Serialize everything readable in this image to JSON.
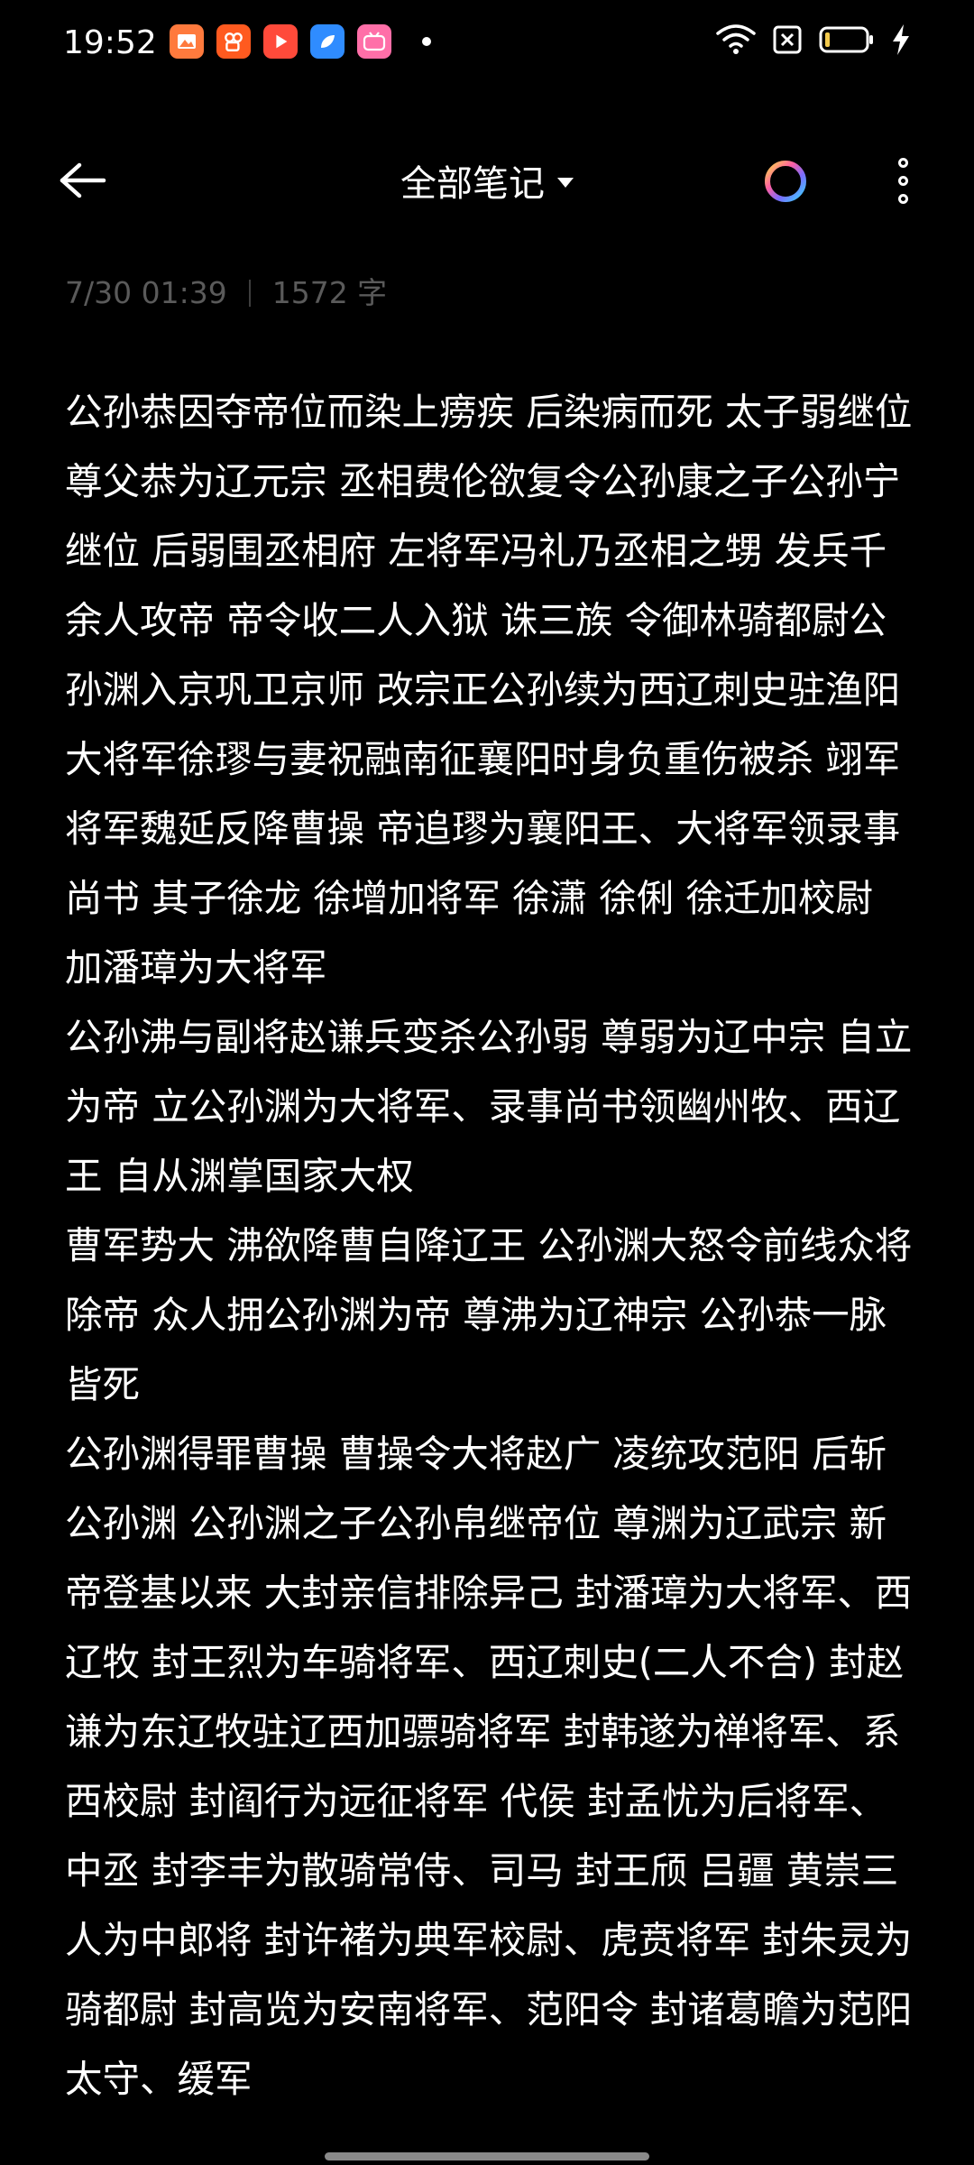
{
  "status_bar": {
    "time": "19:52",
    "notifications": [
      {
        "icon": "gallery-app-icon",
        "color": "#ff7a3d"
      },
      {
        "icon": "kuaishou-app-icon",
        "color": "#ff5a1f"
      },
      {
        "icon": "video-app-icon",
        "color": "#ff4a3a"
      },
      {
        "icon": "blue-app-icon",
        "color": "#2f8cff"
      },
      {
        "icon": "bilibili-app-icon",
        "color": "#ff6fa8"
      }
    ]
  },
  "header": {
    "title": "全部笔记"
  },
  "meta": {
    "timestamp": "7/30 01:39",
    "word_count": "1572 字"
  },
  "note": {
    "content": "公孙恭因夺帝位而染上痨疾 后染病而死 太子弱继位 尊父恭为辽元宗 丞相费伦欲复令公孙康之子公孙宁继位 后弱围丞相府 左将军冯礼乃丞相之甥 发兵千余人攻帝 帝令收二人入狱 诛三族 令御林骑都尉公孙渊入京巩卫京师 改宗正公孙续为西辽刺史驻渔阳\n大将军徐璆与妻祝融南征襄阳时身负重伤被杀 翊军将军魏延反降曹操 帝追璆为襄阳王、大将军领录事尚书 其子徐龙 徐增加将军 徐潇 徐俐 徐迁加校尉 加潘璋为大将军\n公孙沸与副将赵谦兵变杀公孙弱 尊弱为辽中宗 自立为帝 立公孙渊为大将军、录事尚书领幽州牧、西辽王 自从渊掌国家大权\n曹军势大 沸欲降曹自降辽王 公孙渊大怒令前线众将除帝 众人拥公孙渊为帝 尊沸为辽神宗 公孙恭一脉皆死\n公孙渊得罪曹操 曹操令大将赵广 凌统攻范阳 后斩公孙渊 公孙渊之子公孙帛继帝位 尊渊为辽武宗 新帝登基以来 大封亲信排除异己 封潘璋为大将军、西辽牧 封王烈为车骑将军、西辽刺史(二人不合) 封赵谦为东辽牧驻辽西加骠骑将军 封韩遂为禅将军、系西校尉 封阎行为远征将军 代侯 封孟忧为后将军、中丞 封李丰为散骑常侍、司马 封王颀 吕疆 黄崇三人为中郎将 封许褚为典军校尉、虎贲将军 封朱灵为骑都尉 封高览为安南将军、范阳令 封诸葛瞻为范阳太守、缓军"
  }
}
